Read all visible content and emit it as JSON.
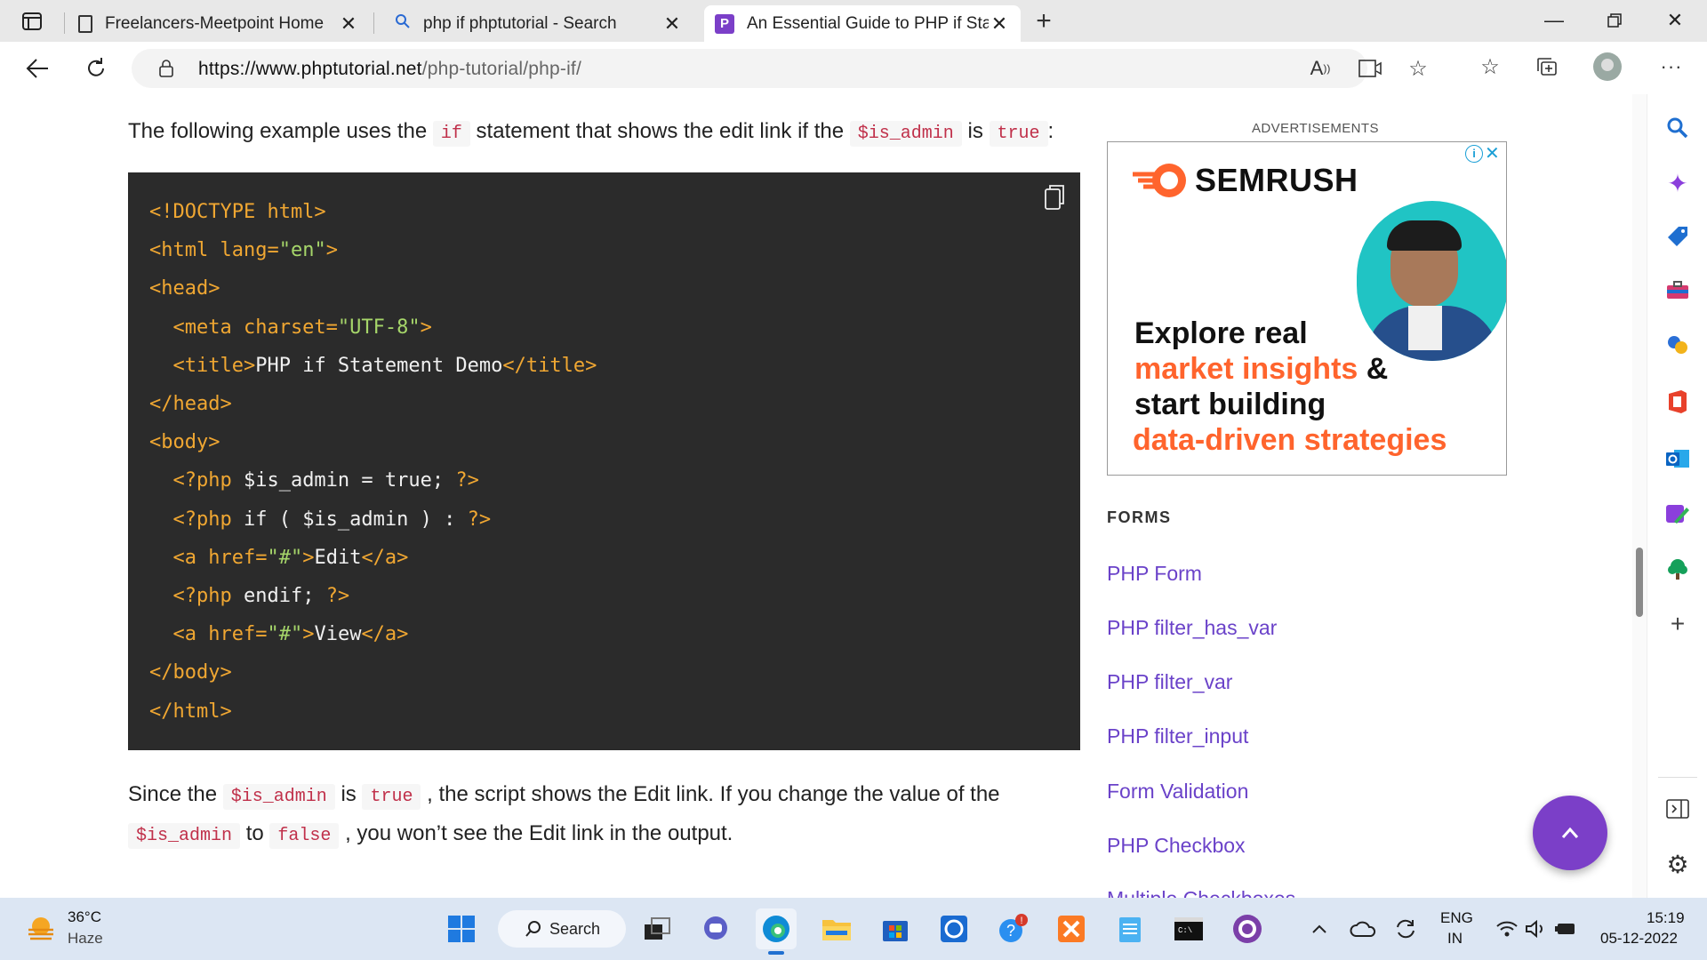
{
  "browser": {
    "tabs": [
      {
        "title": "Freelancers-Meetpoint Home"
      },
      {
        "title": "php if phptutorial - Search"
      },
      {
        "title": "An Essential Guide to PHP if Statement"
      }
    ],
    "url_domain": "https://www.phptutorial.net",
    "url_path": "/php-tutorial/php-if/"
  },
  "article": {
    "intro": {
      "t1": "The following example uses the",
      "c1": "if",
      "t2": "statement that shows the edit link if the",
      "c2": "$is_admin",
      "t3": "is",
      "c3": "true",
      "t4": ":"
    },
    "code_lines": [
      {
        "a": "<!DOCTYPE html>",
        "b": "",
        "c": "",
        "d": "",
        "e": ""
      },
      {
        "a": "<html lang=",
        "b": "\"en\"",
        "c": ">",
        "d": "",
        "e": ""
      },
      {
        "a": "<head>",
        "b": "",
        "c": "",
        "d": "",
        "e": ""
      },
      {
        "a": "  <meta charset=",
        "b": "\"UTF-8\"",
        "c": ">",
        "d": "",
        "e": ""
      },
      {
        "a": "  <title>",
        "b": "",
        "c": "",
        "d": "PHP if Statement Demo",
        "e": "</title>"
      },
      {
        "a": "</head>",
        "b": "",
        "c": "",
        "d": "",
        "e": ""
      },
      {
        "a": "<body>",
        "b": "",
        "c": "",
        "d": "",
        "e": ""
      },
      {
        "a": "  <?php",
        "b": "",
        "c": "",
        "d": " $is_admin = true; ",
        "e": "?>"
      },
      {
        "a": "  <?php",
        "b": "",
        "c": "",
        "d": " if ( $is_admin ) : ",
        "e": "?>"
      },
      {
        "a": "  <a href=",
        "b": "\"#\"",
        "c": ">",
        "d": "Edit",
        "e": "</a>"
      },
      {
        "a": "  <?php",
        "b": "",
        "c": "",
        "d": " endif; ",
        "e": "?>"
      },
      {
        "a": "  <a href=",
        "b": "\"#\"",
        "c": ">",
        "d": "View",
        "e": "</a>"
      },
      {
        "a": "</body>",
        "b": "",
        "c": "",
        "d": "",
        "e": ""
      },
      {
        "a": "</html>",
        "b": "",
        "c": "",
        "d": "",
        "e": ""
      }
    ],
    "outro": {
      "t1": "Since the",
      "c1": "$is_admin",
      "t2": "is",
      "c2": "true",
      "t3": ", the script shows the Edit link. If you change the value of the",
      "c3": "$is_admin",
      "t4": "to",
      "c4": "false",
      "t5": ", you won’t see the Edit link in the output."
    }
  },
  "sidebar": {
    "ad_label": "ADVERTISEMENTS",
    "ad": {
      "brand": "SEMRUSH",
      "line1": "Explore real",
      "line2a": "market insights",
      "line2b": " &",
      "line3": "start building",
      "line4": "data-driven strategies"
    },
    "section_title": "FORMS",
    "links": [
      "PHP Form",
      "PHP filter_has_var",
      "PHP filter_var",
      "PHP filter_input",
      "Form Validation",
      "PHP Checkbox",
      "Multiple Checkboxes"
    ]
  },
  "taskbar": {
    "weather_temp": "36°C",
    "weather_desc": "Haze",
    "search_label": "Search",
    "lang_top": "ENG",
    "lang_bottom": "IN",
    "time": "15:19",
    "date": "05-12-2022"
  },
  "colors": {
    "accent": "#7b3fc8",
    "link": "#6a42c9",
    "code_bg": "#2b2b2b",
    "code_tag": "#f0a732",
    "code_string": "#a6d66a",
    "semrush_orange": "#ff642d"
  }
}
